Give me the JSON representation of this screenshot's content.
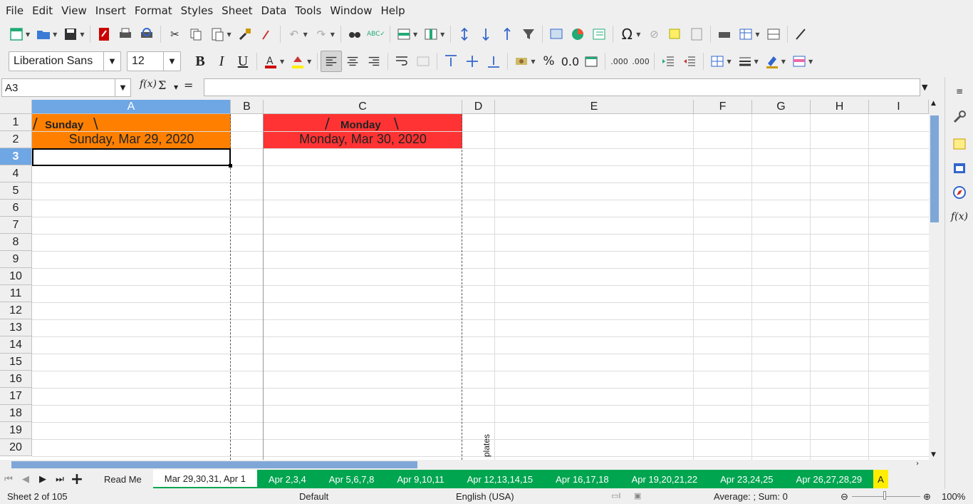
{
  "menu": [
    "File",
    "Edit",
    "View",
    "Insert",
    "Format",
    "Styles",
    "Sheet",
    "Data",
    "Tools",
    "Window",
    "Help"
  ],
  "toolbar": {
    "font_name": "Liberation Sans",
    "font_size": "12",
    "bold": "B",
    "italic": "I",
    "underline": "U",
    "percent": "%",
    "decimal": "0.0",
    "add_decimal": ".000",
    "del_decimal": ".000",
    "special_char": "Ω"
  },
  "formula_bar": {
    "name_box": "A3",
    "fx": "f(x)",
    "sum": "Σ",
    "equals": "=",
    "content": ""
  },
  "columns": [
    "A",
    "B",
    "C",
    "D",
    "E",
    "F",
    "G",
    "H",
    "I"
  ],
  "rows": [
    "1",
    "2",
    "3",
    "4",
    "5",
    "6",
    "7",
    "8",
    "9",
    "10",
    "11",
    "12",
    "13",
    "14",
    "15",
    "16",
    "17",
    "18",
    "19",
    "20"
  ],
  "cells": {
    "a1_label": "Sunday",
    "a2_date": "Sunday,  Mar 29, 2020",
    "c1_label": "Monday",
    "c2_date": "Monday,  Mar 30, 2020",
    "slash_left": "/",
    "slash_right": "\\",
    "d20_vertical": "plates"
  },
  "colors": {
    "sunday": "#ff8000",
    "monday": "#ff3333",
    "tab_green": "#00a550",
    "selection": "#6fa6e4"
  },
  "sheet_tabs": [
    {
      "label": "Read Me",
      "style": "plain"
    },
    {
      "label": "Mar 29,30,31, Apr 1",
      "style": "active"
    },
    {
      "label": "Apr 2,3,4",
      "style": "green"
    },
    {
      "label": "Apr 5,6,7,8",
      "style": "green"
    },
    {
      "label": "Apr 9,10,11",
      "style": "green"
    },
    {
      "label": "Apr 12,13,14,15",
      "style": "green"
    },
    {
      "label": "Apr 16,17,18",
      "style": "green"
    },
    {
      "label": "Apr 19,20,21,22",
      "style": "green"
    },
    {
      "label": "Apr 23,24,25",
      "style": "green"
    },
    {
      "label": "Apr 26,27,28,29",
      "style": "green"
    },
    {
      "label": "A",
      "style": "yellow"
    }
  ],
  "status": {
    "sheet": "Sheet 2 of 105",
    "page_style": "Default",
    "language": "English (USA)",
    "summary": "Average: ; Sum: 0",
    "zoom": "100%"
  }
}
